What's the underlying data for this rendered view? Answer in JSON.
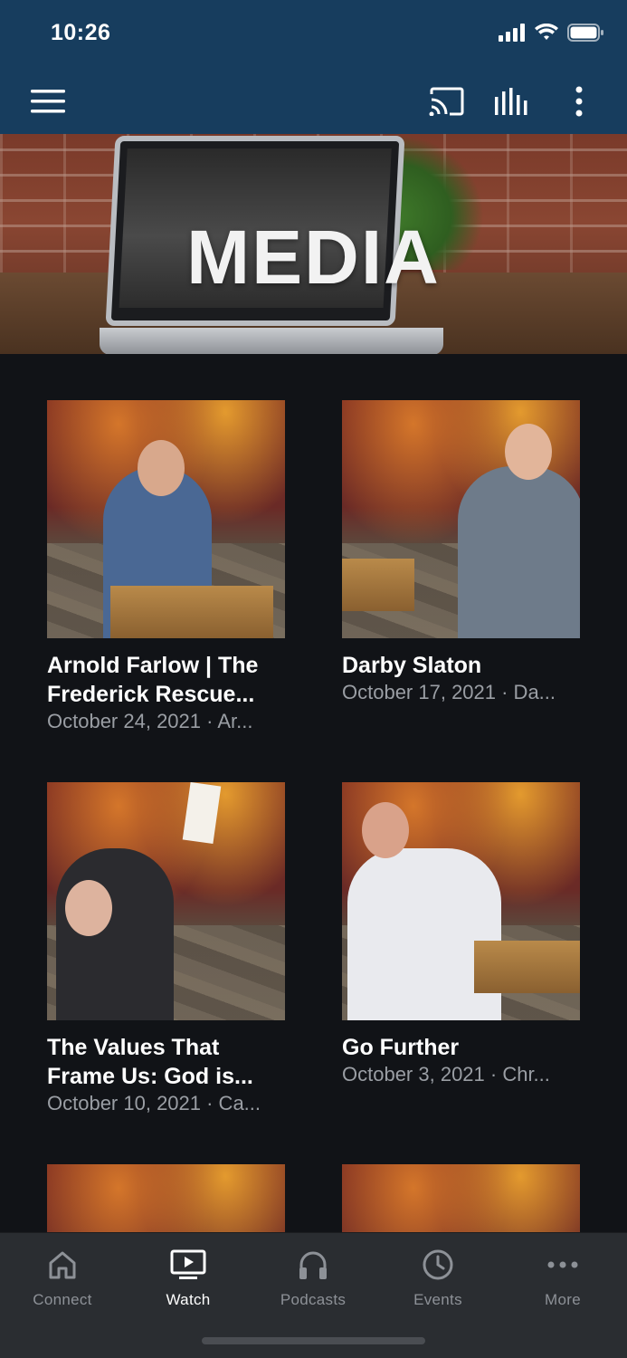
{
  "status_bar": {
    "time": "10:26",
    "icons": [
      "signal-icon",
      "wifi-icon",
      "battery-icon"
    ]
  },
  "app_bar": {
    "icons": [
      "menu-icon",
      "cast-icon",
      "equalizer-icon",
      "more-vertical-icon"
    ],
    "background": "#173d5e"
  },
  "hero": {
    "title": "MEDIA"
  },
  "sermons": [
    {
      "title": "Arnold Farlow | The Frederick Rescue...",
      "subtitle": "October 24, 2021 · Ar..."
    },
    {
      "title": "Darby Slaton",
      "subtitle": "October 17, 2021 · Da..."
    },
    {
      "title": "The Values That Frame Us: God is...",
      "subtitle": "October 10, 2021 · Ca..."
    },
    {
      "title": "Go Further",
      "subtitle": "October 3, 2021 · Chr..."
    }
  ],
  "tabs": [
    {
      "label": "Connect",
      "icon": "home-icon",
      "active": false
    },
    {
      "label": "Watch",
      "icon": "tv-play-icon",
      "active": true
    },
    {
      "label": "Podcasts",
      "icon": "headphones-icon",
      "active": false
    },
    {
      "label": "Events",
      "icon": "clock-icon",
      "active": false
    },
    {
      "label": "More",
      "icon": "more-horizontal-icon",
      "active": false
    }
  ],
  "colors": {
    "accent": "#173d5e",
    "background": "#111317",
    "tab_bar": "#2a2d31",
    "text_primary": "#ffffff",
    "text_secondary": "#9a9ea4"
  }
}
